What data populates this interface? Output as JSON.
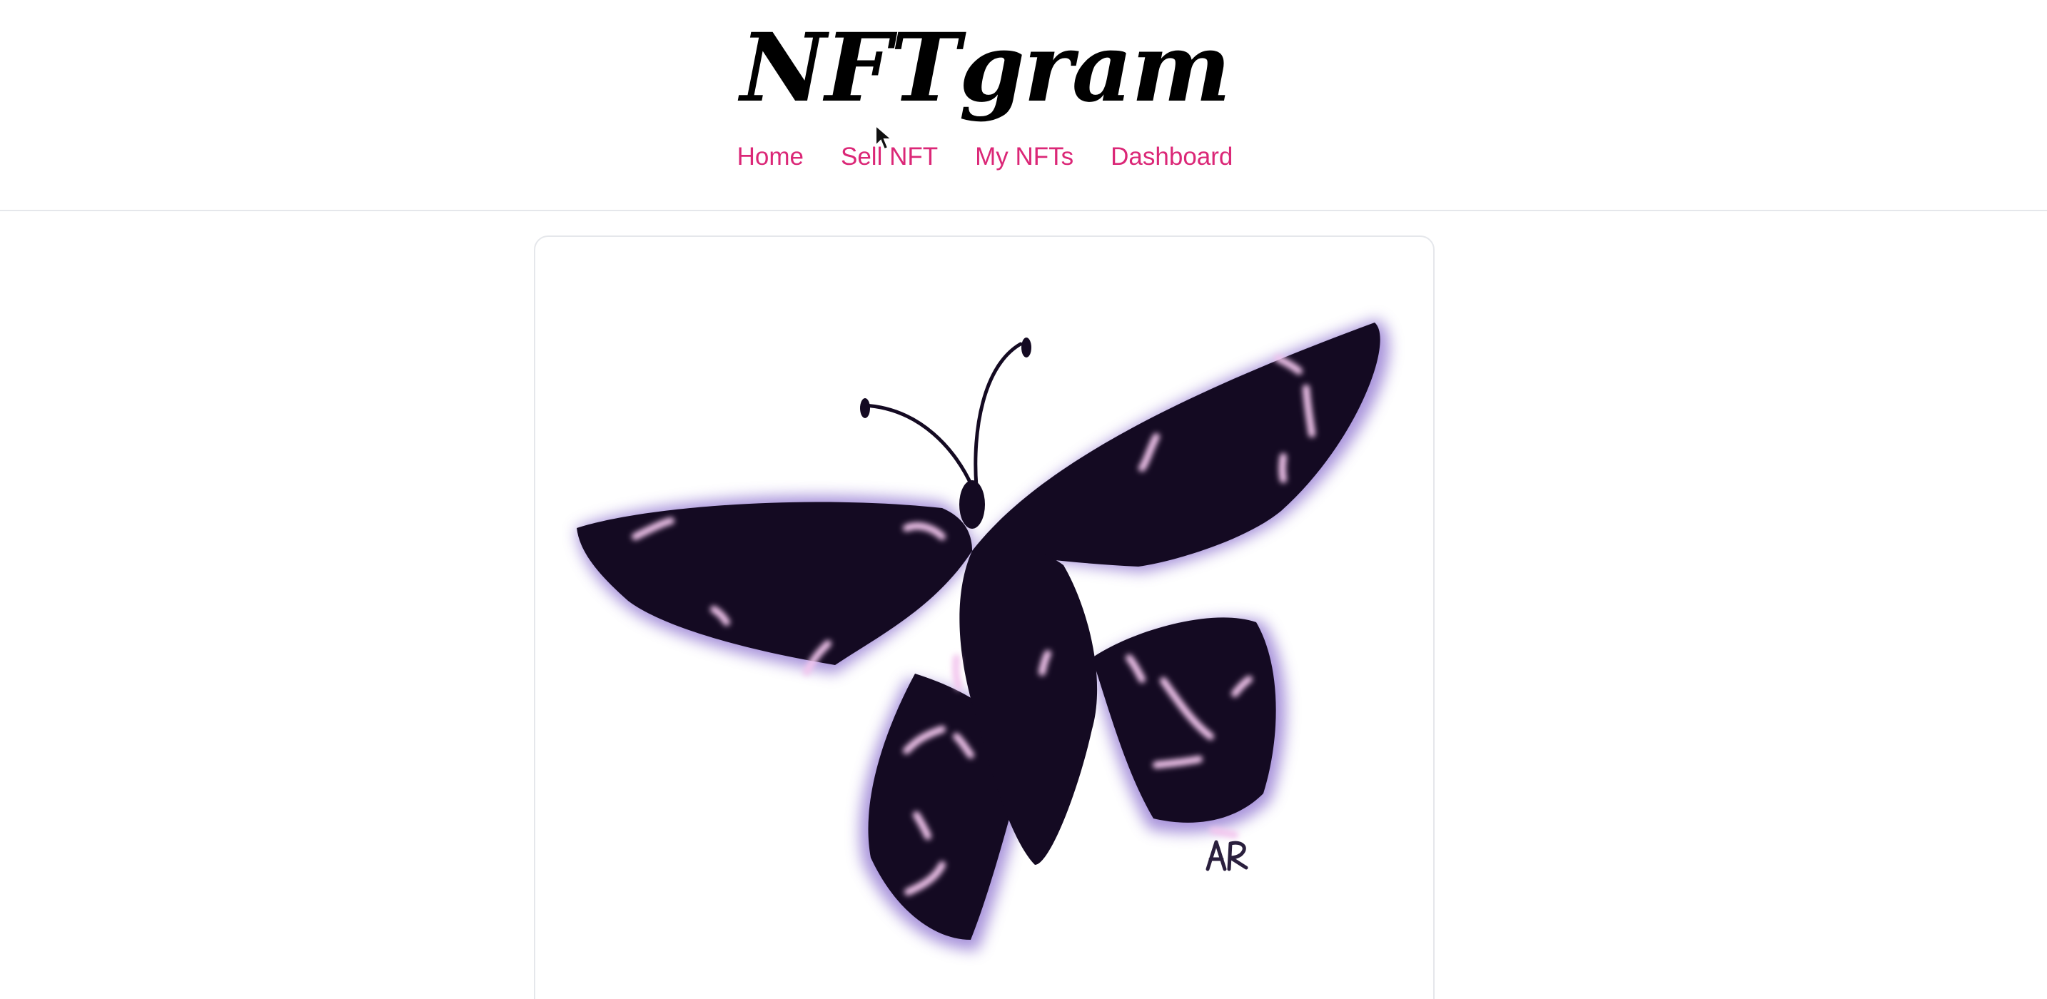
{
  "header": {
    "logo": "NFTgram",
    "nav": [
      {
        "label": "Home"
      },
      {
        "label": "Sell NFT"
      },
      {
        "label": "My NFTs"
      },
      {
        "label": "Dashboard"
      }
    ]
  },
  "card": {
    "image_signature": "AR"
  },
  "colors": {
    "nav_link": "#db2777",
    "butterfly_body": "#140a22",
    "butterfly_glow": "#8b6fcf",
    "butterfly_highlight": "#f3c6ee",
    "divider": "#e5e7eb"
  },
  "icons": {
    "cursor": "mouse-pointer-icon"
  }
}
